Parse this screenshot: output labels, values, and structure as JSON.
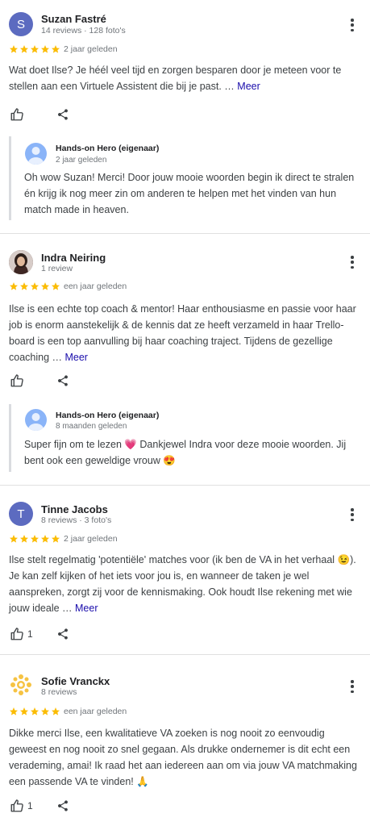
{
  "star_color": "#fbbc04",
  "link_color": "#1a0dab",
  "reviews": [
    {
      "avatar_letter": "S",
      "avatar_color": "#5c6bc0",
      "name": "Suzan Fastré",
      "meta": "14 reviews · 128 foto's",
      "rating": 5,
      "date": "2 jaar geleden",
      "text": "Wat doet Ilse? Je héél veel tijd en zorgen besparen door je meteen voor te stellen aan een Virtuele Assistent die bij je past. … ",
      "more": "Meer",
      "likes": "",
      "reply": {
        "name": "Hands-on Hero (eigenaar)",
        "date": "2 jaar geleden",
        "text": "Oh wow Suzan! Merci! Door jouw mooie woorden begin ik direct te stralen én krijg ik nog meer zin om anderen te helpen met het vinden van hun match made in heaven."
      }
    },
    {
      "avatar_letter": "",
      "avatar_color": "#4e3b33",
      "name": "Indra Neiring",
      "meta": "1 review",
      "rating": 5,
      "date": "een jaar geleden",
      "text": "Ilse is een echte top coach & mentor! Haar enthousiasme en passie voor haar job is enorm aanstekelijk & de kennis dat ze heeft verzameld in haar Trello-board is een top aanvulling bij haar coaching traject. Tijdens de gezellige coaching … ",
      "more": "Meer",
      "likes": "",
      "reply": {
        "name": "Hands-on Hero (eigenaar)",
        "date": "8 maanden geleden",
        "text": "Super fijn om te lezen 💗 Dankjewel Indra voor deze mooie woorden. Jij bent ook een geweldige vrouw 😍"
      }
    },
    {
      "avatar_letter": "T",
      "avatar_color": "#5c6bc0",
      "name": "Tinne Jacobs",
      "meta": "8 reviews · 3 foto's",
      "rating": 5,
      "date": "2 jaar geleden",
      "text": "Ilse stelt regelmatig 'potentiële' matches voor (ik ben de VA in het verhaal 😉). Je kan zelf kijken of het iets voor jou is, en wanneer de taken je wel aanspreken, zorgt zij voor de kennismaking. Ook houdt Ilse rekening met wie jouw ideale … ",
      "more": "Meer",
      "likes": "1"
    },
    {
      "avatar_letter": "",
      "avatar_color": "#f6c343",
      "name": "Sofie Vranckx",
      "meta": "8 reviews",
      "rating": 5,
      "date": "een jaar geleden",
      "text": "Dikke merci Ilse, een kwalitatieve VA zoeken is nog nooit zo eenvoudig geweest en nog nooit zo snel gegaan. Als drukke ondernemer is dit echt een verademing, amai! Ik raad het aan iedereen aan om via jouw VA matchmaking een passende VA te vinden! 🙏",
      "more": "",
      "likes": "1"
    }
  ]
}
